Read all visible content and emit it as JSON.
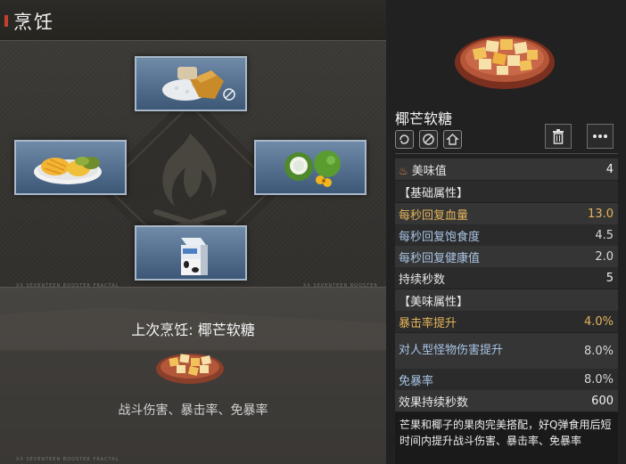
{
  "screen": {
    "title": "烹饪",
    "codes": [
      "XX SEVENTEEN BOOSTER FRACTAL",
      "XX SEVENTEEN BOOSTER FRACTAL",
      "XX SEVENTEEN BOOSTER FRACTAL"
    ]
  },
  "slots": {
    "top": {
      "item": "salt-and-sugar-icon"
    },
    "left": {
      "item": "mango-plate-icon"
    },
    "right": {
      "item": "coconut-icon"
    },
    "bottom": {
      "item": "milk-carton-icon"
    }
  },
  "last_cook": {
    "title": "上次烹饪: 椰芒软糖",
    "effects": "战斗伤害、暴击率、免暴率"
  },
  "detail": {
    "name": "椰芒软糖",
    "tag_icons": [
      "stomach-icon",
      "no-icon",
      "home-icon"
    ],
    "taste_label": "美味值",
    "taste_value": "4",
    "basic_header": "【基础属性】",
    "basic": [
      {
        "label": "每秒回复血量",
        "value": "13.0"
      },
      {
        "label": "每秒回复饱食度",
        "value": "4.5"
      },
      {
        "label": "每秒回复健康值",
        "value": "2.0"
      },
      {
        "label": "持续秒数",
        "value": "5"
      }
    ],
    "taste_header": "【美味属性】",
    "taste": [
      {
        "label": "暴击率提升",
        "value": "4.0%"
      },
      {
        "label": "对人型怪物伤害提升",
        "value": "8.0%"
      },
      {
        "label": "免暴率",
        "value": "8.0%"
      },
      {
        "label": "效果持续秒数",
        "value": "600"
      }
    ],
    "description": "芒果和椰子的果肉完美搭配，好Q弹食用后短时间内提升战斗伤害、暴击率、免暴率"
  },
  "colors": {
    "accent_gold": "#e4b45a",
    "accent_blue": "#a9c4e6",
    "slot_blue": "#5b7898",
    "red_marker": "#c2412d"
  }
}
